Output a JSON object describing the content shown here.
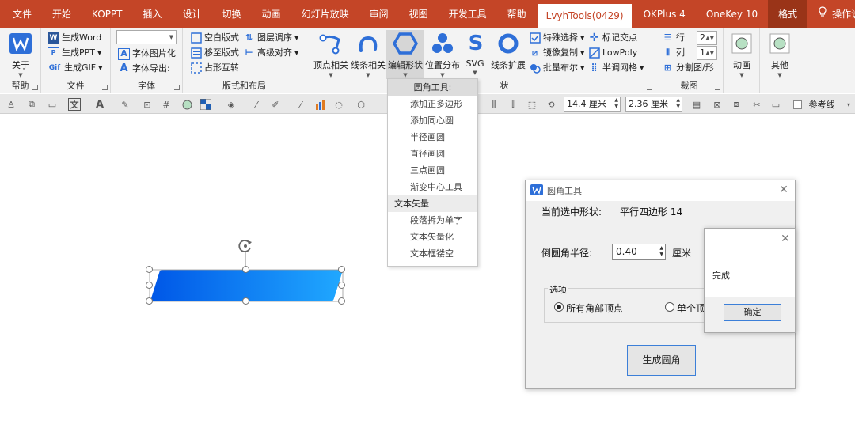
{
  "menubar": {
    "tabs": [
      "文件",
      "开始",
      "KOPPT",
      "插入",
      "设计",
      "切换",
      "动画",
      "幻灯片放映",
      "审阅",
      "视图",
      "开发工具",
      "帮助"
    ],
    "active_tab": "LvyhTools(0429)",
    "extra_tabs": [
      "OKPlus 4",
      "OneKey 10"
    ],
    "format_tab": "格式",
    "help_search": "操作说明搜索"
  },
  "ribbon": {
    "help_group": {
      "about": "关于",
      "label": "帮助"
    },
    "file_group": {
      "gen_word": "生成Word",
      "gen_ppt": "生成PPT",
      "gen_gif": "生成GIF",
      "label": "文件"
    },
    "font_group": {
      "font_select": "",
      "font_to_image": "字体图片化",
      "font_export": "字体导出:",
      "label": "字体"
    },
    "layout_group": {
      "blank_layout": "空白版式",
      "move_to_layout": "移至版式",
      "placeholder_swap": "占形互转",
      "layer_order": "图层调序",
      "advanced_align": "高级对齐",
      "label": "版式和布局"
    },
    "shape_group": {
      "vertex": "顶点相关",
      "line": "线条相关",
      "edit_shape": "编辑形状",
      "position_dist": "位置分布",
      "svg": "SVG",
      "line_expand": "线条扩展",
      "special_select": "特殊选择",
      "mirror_copy": "镜像复制",
      "batch_boolean": "批量布尔",
      "mark_intersection": "标记交点",
      "lowpoly": "LowPoly",
      "halftone": "半调网格",
      "label_tail": "状"
    },
    "grid_group": {
      "rows": "行",
      "cols": "列",
      "rows_value": "2",
      "cols_value": "1",
      "split": "分割图/形",
      "label": "裁图"
    },
    "anim_group": {
      "label": "动画"
    },
    "other_group": {
      "label": "其他"
    }
  },
  "format_toolbar": {
    "width_value": "14.4 厘米",
    "height_value": "2.36 厘米",
    "guide_lines": "参考线"
  },
  "dropdown": {
    "section1": "圆角工具:",
    "items1": [
      "添加正多边形",
      "添加同心圆",
      "半径画圆",
      "直径画圆",
      "三点画圆",
      "渐变中心工具"
    ],
    "section2": "文本矢量",
    "items2": [
      "段落拆为单字",
      "文本矢量化",
      "文本框镂空"
    ]
  },
  "dialog": {
    "title": "圆角工具",
    "current_shape_label": "当前选中形状:",
    "current_shape_value": "平行四边形 14",
    "radius_label": "倒圆角半径:",
    "radius_value": "0.40",
    "radius_unit": "厘米",
    "options_label": "选项",
    "option_all": "所有角部顶点",
    "option_single": "单个顶",
    "generate_button": "生成圆角"
  },
  "message_box": {
    "text": "完成",
    "ok_button": "确定"
  },
  "colors": {
    "menubar_bg": "#c44527",
    "shape_gradient_start": "#0057e7",
    "shape_gradient_end": "#20a8ff",
    "accent_blue": "#2e6fd8"
  }
}
